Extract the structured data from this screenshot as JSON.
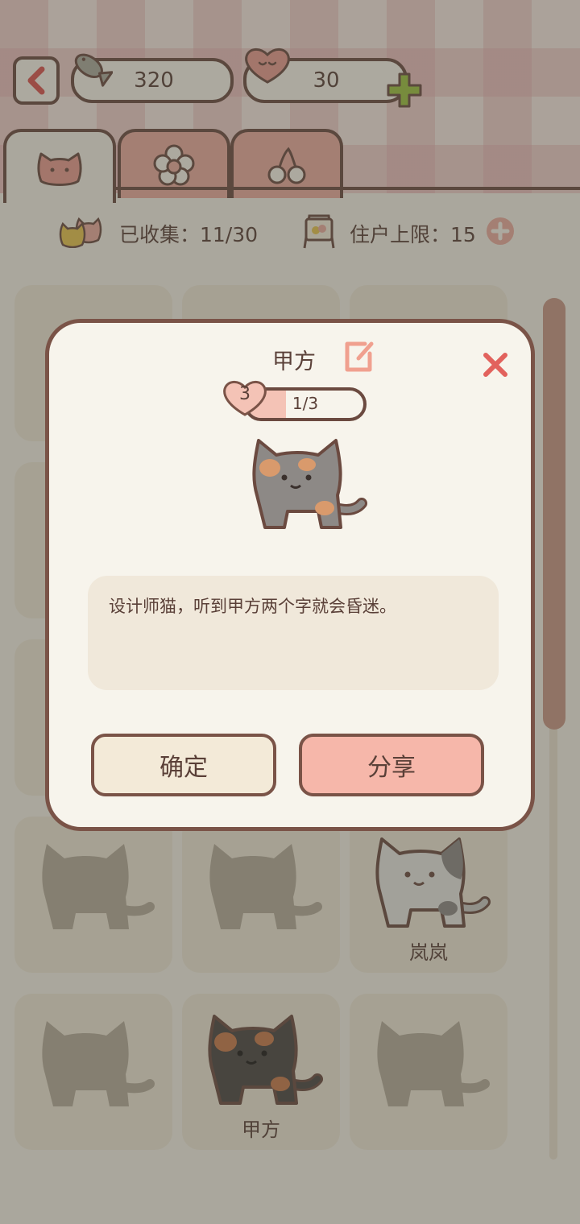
{
  "header": {
    "fish_count": "320",
    "heart_count": "30"
  },
  "tabs": [
    {
      "icon": "cat-face-icon",
      "active": true
    },
    {
      "icon": "flower-icon",
      "active": false
    },
    {
      "icon": "cherry-icon",
      "active": false
    }
  ],
  "stats": {
    "collected_label": "已收集：11/30",
    "resident_label": "住户上限：15"
  },
  "grid": {
    "named_cats": [
      {
        "name": "岚岚"
      },
      {
        "name": "甲方"
      }
    ]
  },
  "dialog": {
    "cat_name": "甲方",
    "level": "3",
    "progress_text": "1/3",
    "progress_fraction": 0.333,
    "description": "设计师猫，听到甲方两个字就会昏迷。",
    "confirm_label": "确定",
    "share_label": "分享"
  },
  "colors": {
    "border_brown": "#6b4a40",
    "accent_pink": "#f6b7aa",
    "close_red": "#e2625d",
    "plus_green": "#9bbf3e"
  }
}
